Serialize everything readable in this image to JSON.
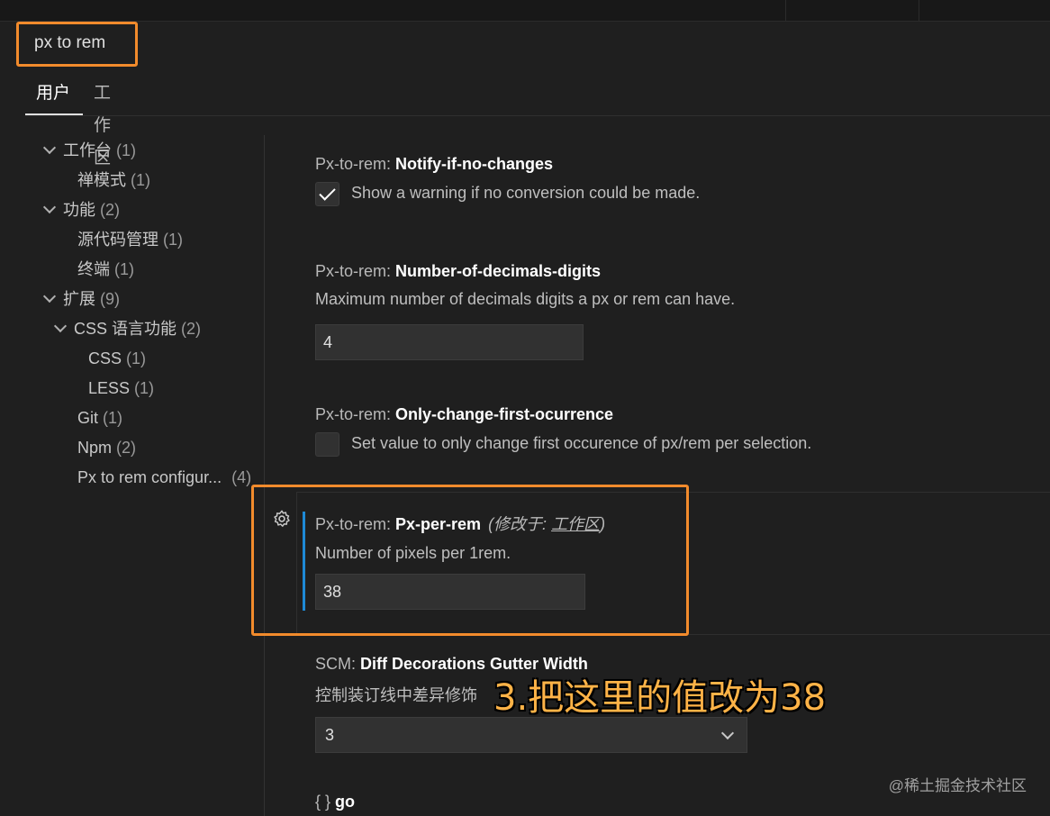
{
  "search": {
    "value": "px to rem"
  },
  "scope_tabs": [
    {
      "label": "用户",
      "active": true
    },
    {
      "label": "工作区",
      "active": false
    }
  ],
  "toc": [
    {
      "label": "工作台",
      "count": "(1)"
    },
    {
      "label": "禅模式",
      "count": "(1)"
    },
    {
      "label": "功能",
      "count": "(2)"
    },
    {
      "label": "源代码管理",
      "count": "(1)"
    },
    {
      "label": "终端",
      "count": "(1)"
    },
    {
      "label": "扩展",
      "count": "(9)"
    },
    {
      "label": "CSS 语言功能",
      "count": "(2)"
    },
    {
      "label": "CSS",
      "count": "(1)"
    },
    {
      "label": "LESS",
      "count": "(1)"
    },
    {
      "label": "Git",
      "count": "(1)"
    },
    {
      "label": "Npm",
      "count": "(2)"
    },
    {
      "label": "Px to rem configur...",
      "count": "(4)"
    }
  ],
  "settings": {
    "notify": {
      "category": "Px-to-rem: ",
      "key": "Notify-if-no-changes",
      "description": "Show a warning if no conversion could be made.",
      "checked": true
    },
    "decimals": {
      "category": "Px-to-rem: ",
      "key": "Number-of-decimals-digits",
      "description": "Maximum number of decimals digits a px or rem can have.",
      "value": "4"
    },
    "first": {
      "category": "Px-to-rem: ",
      "key": "Only-change-first-ocurrence",
      "description": "Set value to only change first occurence of px/rem per selection.",
      "checked": false
    },
    "per_rem": {
      "category": "Px-to-rem: ",
      "key": "Px-per-rem",
      "modified_prefix": "(修改于: ",
      "modified_link": "工作区",
      "modified_suffix": ")",
      "description": "Number of pixels per 1rem.",
      "value": "38"
    },
    "scm": {
      "category": "SCM: ",
      "key": "Diff Decorations Gutter Width",
      "description": "控制装订线中差异修饰",
      "value": "3"
    },
    "go": {
      "braces": "{ }",
      "key": "go"
    }
  },
  "annotation": "3.把这里的值改为38",
  "watermark": "@稀土掘金技术社区",
  "colors": {
    "highlight": "#f28b2c",
    "focus_bar": "#1e8ad6",
    "background": "#1f1f1f"
  }
}
